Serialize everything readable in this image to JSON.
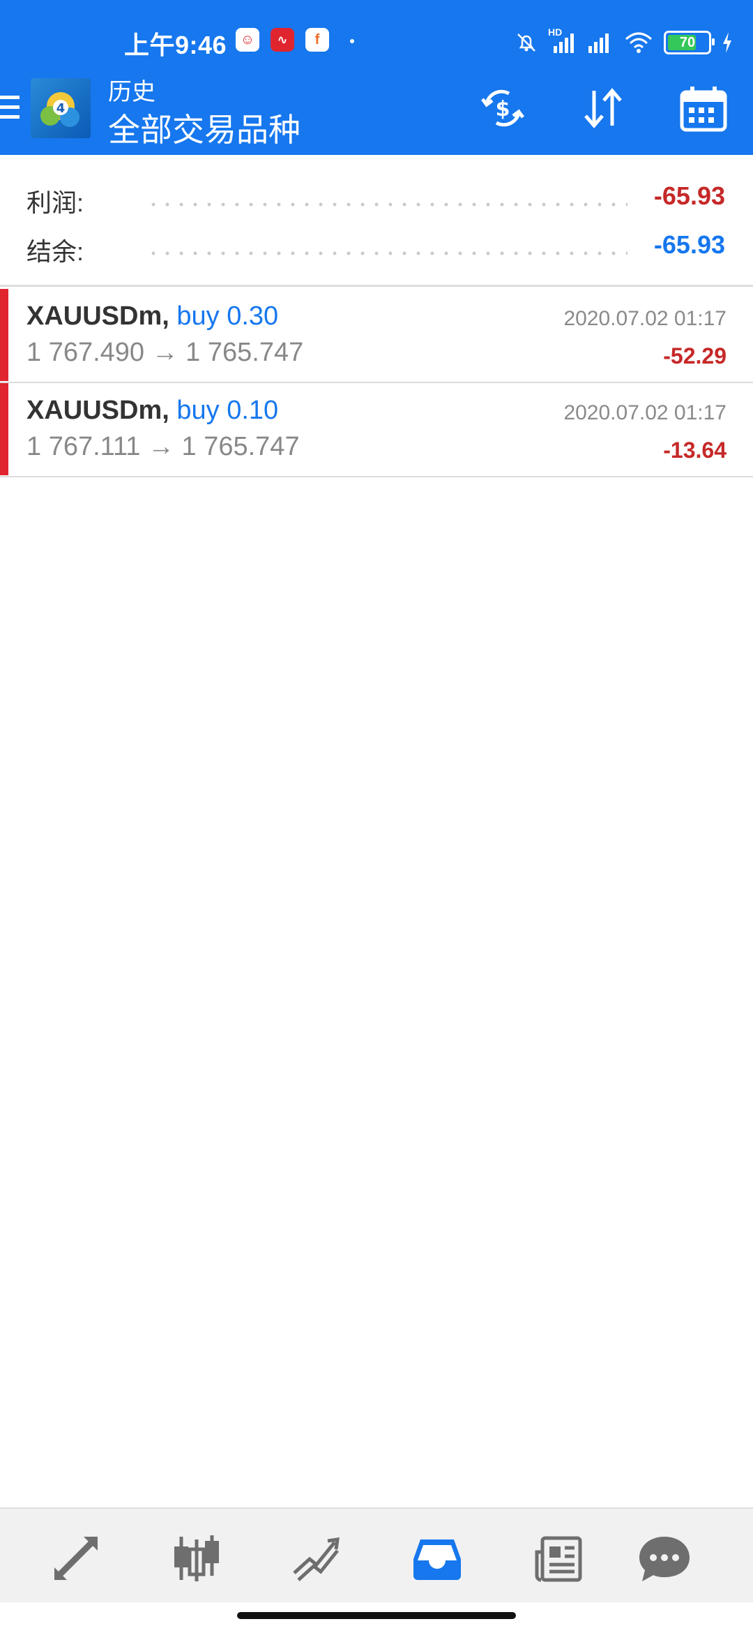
{
  "status_bar": {
    "time": "上午9:46",
    "signal_hd": "HD",
    "battery_level": "70"
  },
  "header": {
    "title": "历史",
    "subtitle": "全部交易品种",
    "accent_color": "#1677ee"
  },
  "summary": {
    "profit_label": "利润:",
    "profit_value": "-65.93",
    "balance_label": "结余:",
    "balance_value": "-65.93"
  },
  "trades": [
    {
      "symbol": "XAUUSDm,",
      "side": "buy 0.30",
      "prices": "1 767.490 → 1 765.747",
      "time": "2020.07.02 01:17",
      "profit": "-52.29"
    },
    {
      "symbol": "XAUUSDm,",
      "side": "buy 0.10",
      "prices": "1 767.111 → 1 765.747",
      "time": "2020.07.02 01:17",
      "profit": "-13.64"
    }
  ],
  "bottom_nav": {
    "items": [
      "trade-icon",
      "quotes-icon",
      "chart-icon",
      "history-icon",
      "news-icon",
      "chat-icon"
    ],
    "active": "history-icon"
  }
}
